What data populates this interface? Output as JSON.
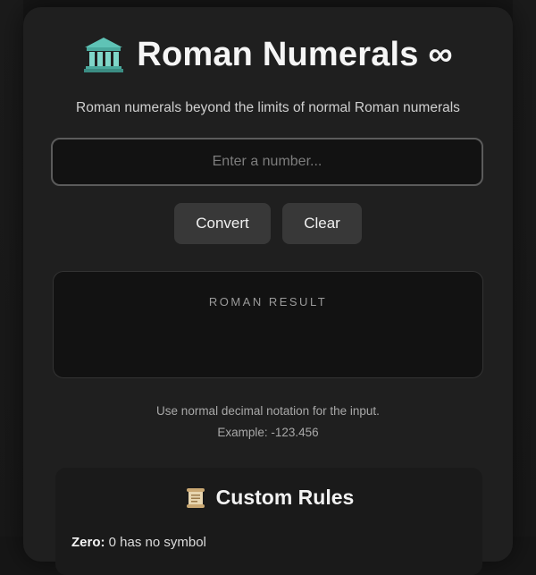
{
  "app": {
    "title": "Roman Numerals ∞",
    "subtitle": "Roman numerals beyond the limits of normal Roman numerals"
  },
  "input": {
    "value": "",
    "placeholder": "Enter a number..."
  },
  "buttons": {
    "convert_label": "Convert",
    "clear_label": "Clear"
  },
  "result": {
    "label": "ROMAN RESULT",
    "value": ""
  },
  "hints": {
    "line1": "Use normal decimal notation for the input.",
    "line2": "Example: -123.456"
  },
  "rules": {
    "title": "Custom Rules",
    "items": [
      {
        "term": "Zero:",
        "text": " 0 has no symbol"
      }
    ]
  },
  "icons": {
    "title_icon": "classical-building-icon",
    "rules_icon": "scroll-icon"
  },
  "colors": {
    "background": "#161616",
    "card": "#1f1f1f",
    "button": "#383838",
    "input_bg": "#121212",
    "input_border": "#5b5b5b",
    "temple_teal": "#5fc3b6"
  }
}
